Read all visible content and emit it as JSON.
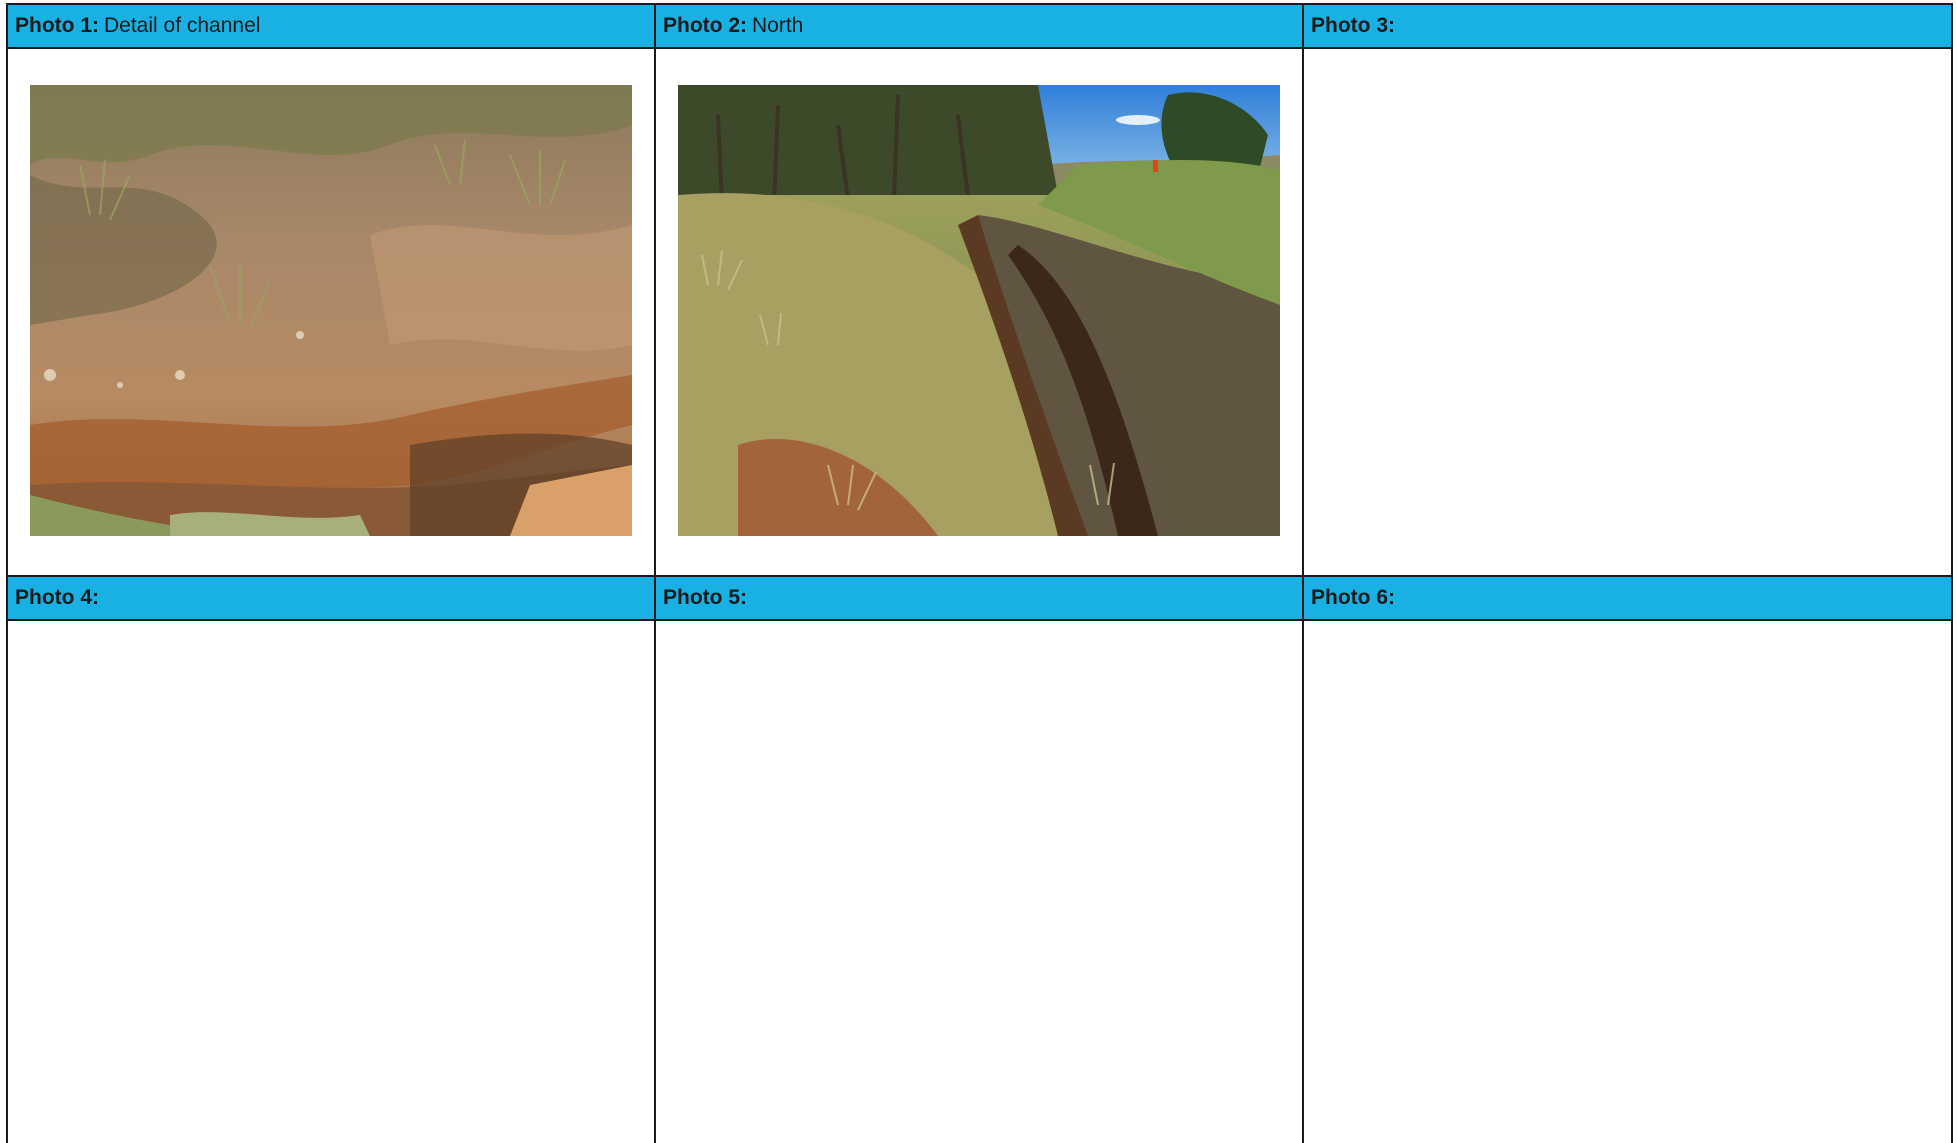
{
  "photos": [
    {
      "label": "Photo 1:",
      "caption": "Detail of channel"
    },
    {
      "label": "Photo 2:",
      "caption": "North"
    },
    {
      "label": "Photo 3:",
      "caption": ""
    },
    {
      "label": "Photo 4:",
      "caption": ""
    },
    {
      "label": "Photo 5:",
      "caption": ""
    },
    {
      "label": "Photo 6:",
      "caption": ""
    }
  ],
  "colors": {
    "header_bg": "#19b1e4",
    "border": "#1a1a1a"
  }
}
